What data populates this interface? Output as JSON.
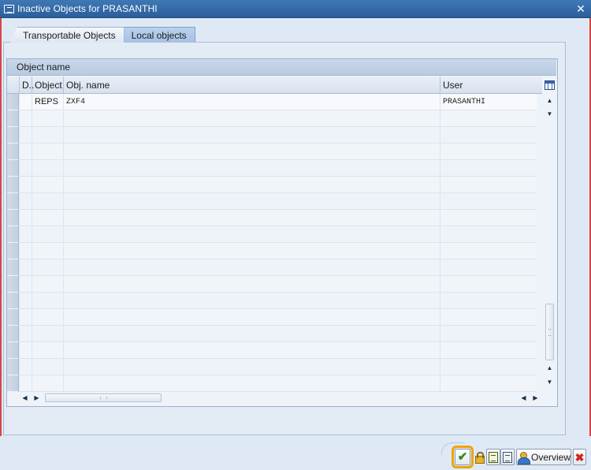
{
  "window": {
    "title": "Inactive Objects for PRASANTHI",
    "close_glyph": "✕"
  },
  "tabs": [
    {
      "label": "Transportable Objects",
      "active": false
    },
    {
      "label": "Local objects",
      "active": true
    }
  ],
  "grid": {
    "title": "Object name",
    "columns": [
      "D..",
      "Object",
      "Obj. name",
      "User"
    ],
    "rows": [
      {
        "d": "",
        "object": "REPS",
        "obj_name": "ZXF4",
        "user": "PRASANTHI"
      }
    ],
    "empty_rows": 17
  },
  "toolbar": {
    "overview_label": "Overview",
    "check_glyph": "✔",
    "cancel_glyph": "✖"
  },
  "scroll": {
    "up": "▲",
    "down": "▼",
    "left": "◀",
    "right": "▶"
  },
  "colors": {
    "title_bar": "#2f66a5",
    "highlight_outline": "#f0a30a",
    "confirm_green": "#2d8b1b",
    "cancel_red": "#d4251b"
  }
}
